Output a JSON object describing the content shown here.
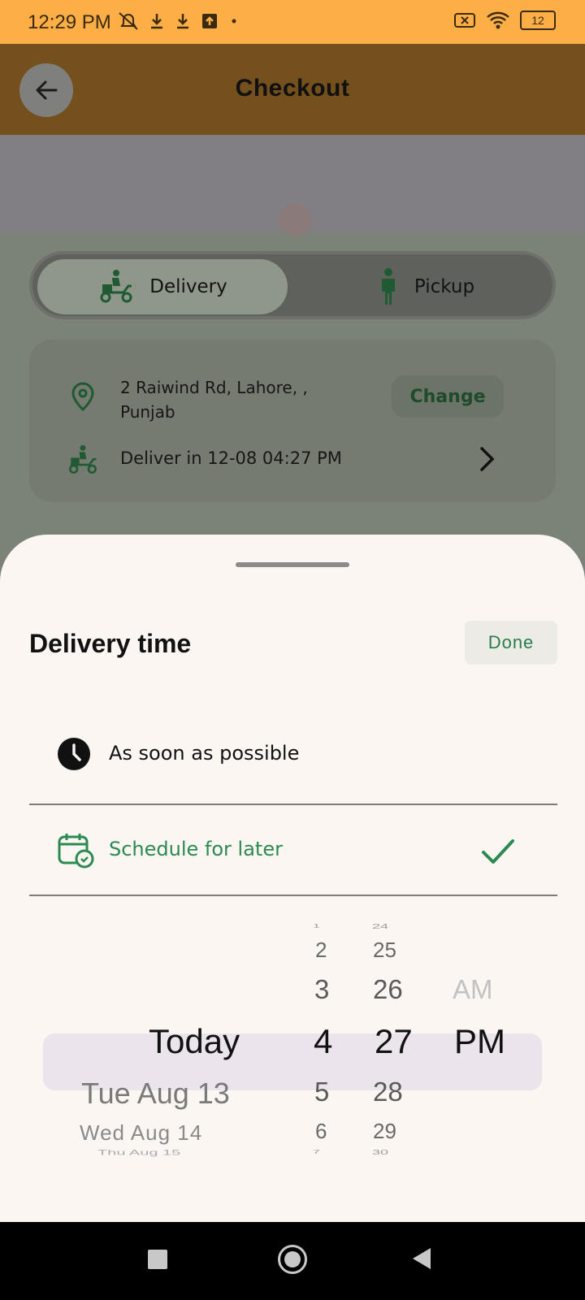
{
  "status_bar": {
    "time": "12:29 PM",
    "battery": "12",
    "icons": [
      "mute-icon",
      "download-icon",
      "download-icon",
      "upload-icon",
      "dot-icon",
      "no-sim-icon",
      "wifi-icon",
      "battery-icon"
    ]
  },
  "header": {
    "title": "Checkout"
  },
  "mode_toggle": {
    "delivery_label": "Delivery",
    "pickup_label": "Pickup",
    "selected": "Delivery"
  },
  "address": {
    "line1": "2 Raiwind Rd,  Lahore, ,",
    "line2": "Punjab",
    "change_label": "Change",
    "deliver_in": "Deliver in 12-08 04:27 PM"
  },
  "sheet": {
    "title": "Delivery time",
    "done_label": "Done",
    "asap_label": "As soon as possible",
    "later_label": "Schedule for later",
    "selected_option": "Schedule for later"
  },
  "picker": {
    "day": {
      "selected": "Today",
      "below": [
        "Tue Aug 13",
        "Wed Aug 14",
        "Thu Aug 15"
      ]
    },
    "hour": {
      "above": [
        "1",
        "2",
        "3"
      ],
      "selected": "4",
      "below": [
        "5",
        "6",
        "7"
      ]
    },
    "minute": {
      "above": [
        "24",
        "25",
        "26"
      ],
      "selected": "27",
      "below": [
        "28",
        "29",
        "30"
      ]
    },
    "ampm": {
      "above": "AM",
      "selected": "PM"
    }
  },
  "colors": {
    "status_bar": "#fdae47",
    "header": "#74501d",
    "accent_green": "#2b8a52",
    "sheet_bg": "#fcf6f3",
    "picker_highlight": "#ece4ed"
  }
}
